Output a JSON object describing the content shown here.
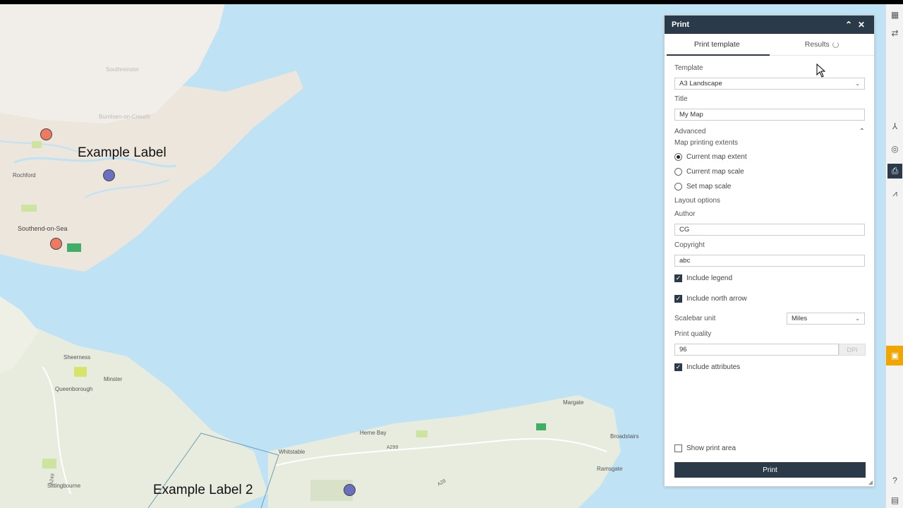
{
  "map": {
    "labels": {
      "example_label": "Example Label",
      "example_label_2": "Example Label 2"
    },
    "places": {
      "southminster": "Southminster",
      "burnham": "Burnham-on-Crouch",
      "rochford": "Rochford",
      "southend": "Southend-on-Sea",
      "sheerness": "Sheerness",
      "minster": "Minster",
      "queenborough": "Queenborough",
      "sittingbourne": "Sittingbourne",
      "whitstable": "Whitstable",
      "herne_bay": "Herne Bay",
      "margate": "Margate",
      "broadstairs": "Broadstairs",
      "ramsgate": "Ramsgate"
    },
    "roads": {
      "a299": "A299",
      "a249": "A249",
      "a28": "A28"
    },
    "pin_colors": {
      "red": "#ee7b61",
      "blue": "#6a6fc2"
    }
  },
  "panel": {
    "title": "Print",
    "tabs": {
      "template": "Print template",
      "results": "Results"
    },
    "template_label": "Template",
    "template_value": "A3 Landscape",
    "title_label": "Title",
    "title_value": "My Map",
    "advanced_label": "Advanced",
    "extents_label": "Map printing extents",
    "extent_options": [
      "Current map extent",
      "Current map scale",
      "Set map scale"
    ],
    "layout_label": "Layout options",
    "author_label": "Author",
    "author_value": "CG",
    "copyright_label": "Copyright",
    "copyright_value": "abc",
    "include_legend": "Include legend",
    "include_north_arrow": "Include north arrow",
    "scalebar_label": "Scalebar unit",
    "scalebar_value": "Miles",
    "quality_label": "Print quality",
    "quality_value": "96",
    "dpi_label": "DPI",
    "include_attributes": "Include attributes",
    "show_print_area": "Show print area",
    "print_button": "Print"
  },
  "colors": {
    "header": "#2b3a48",
    "accent": "#f0a500"
  }
}
